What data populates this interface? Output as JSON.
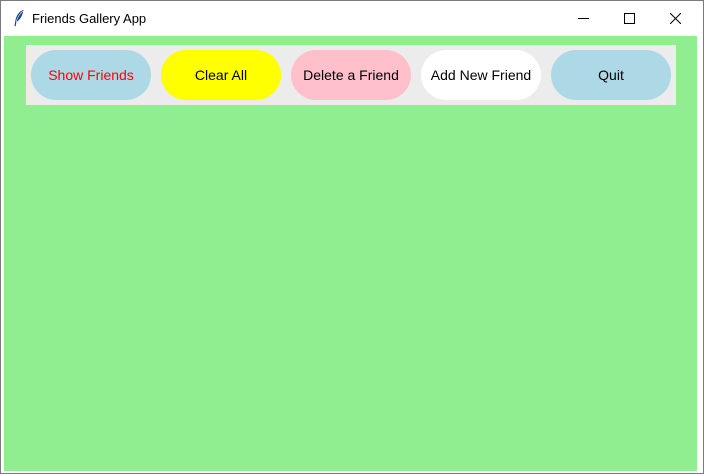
{
  "window": {
    "title": "Friends Gallery App",
    "icon": "feather-icon",
    "controls": {
      "minimize_icon": "minimize-icon",
      "maximize_icon": "maximize-icon",
      "close_icon": "close-icon"
    }
  },
  "colors": {
    "window_background": "#90ee90",
    "toolbar_background": "#ececec"
  },
  "toolbar": {
    "buttons": [
      {
        "label": "Show Friends",
        "background": "#add8e6",
        "text_color": "#ff0000"
      },
      {
        "label": "Clear All",
        "background": "#ffff00",
        "text_color": "#000000"
      },
      {
        "label": "Delete a Friend",
        "background": "#ffc0cb",
        "text_color": "#000000"
      },
      {
        "label": "Add New Friend",
        "background": "#ffffff",
        "text_color": "#000000"
      },
      {
        "label": "Quit",
        "background": "#add8e6",
        "text_color": "#000000"
      }
    ]
  }
}
